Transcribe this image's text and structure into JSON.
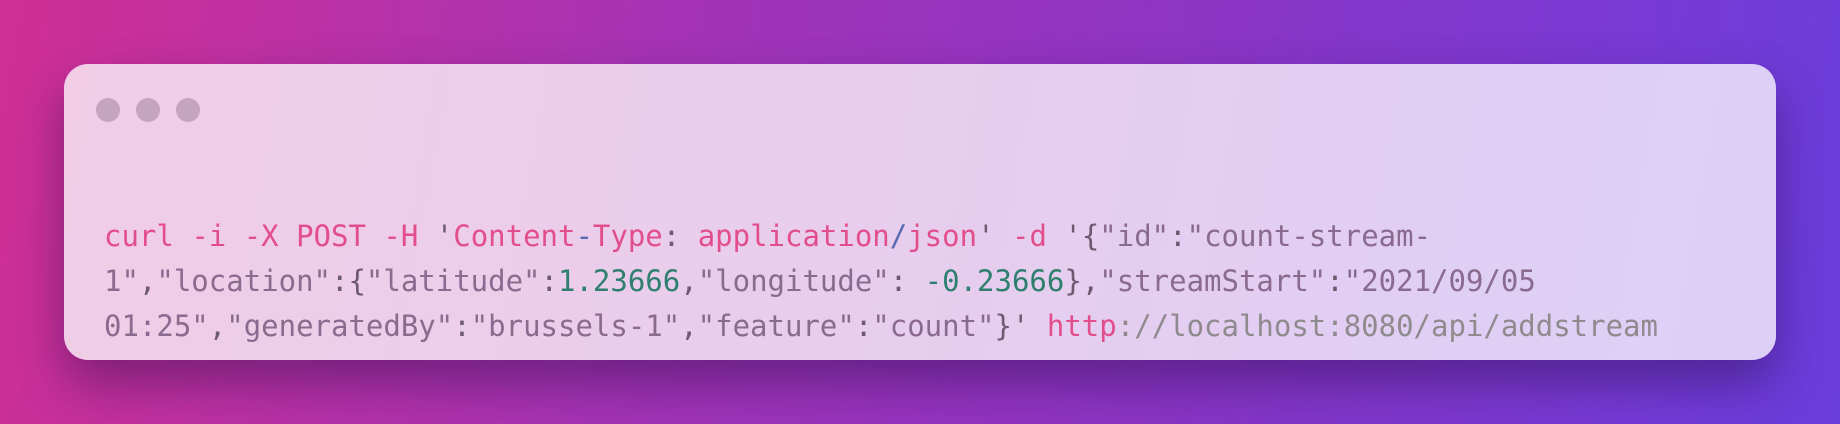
{
  "window": {
    "traffic_lights": [
      "dot",
      "dot",
      "dot"
    ],
    "colors": {
      "background_start": "#d02f95",
      "background_end": "#6b3ddd",
      "card": "#ead0ef",
      "dot": "#c5a4bf",
      "keyword": "#e24e8c",
      "string": "#8a6a8e",
      "number": "#2f7f6e",
      "slash": "#5a6ab0",
      "url": "#8f8a8d"
    }
  },
  "code": {
    "line1": {
      "t1": "curl",
      "t2": " ",
      "t3": "-i",
      "t4": " ",
      "t5": "-X POST",
      "t6": " ",
      "t7": "-H",
      "t8": " '",
      "t9": "Content",
      "t10": "-",
      "t11": "Type",
      "t12": ": ",
      "t13": "application",
      "t14": "/",
      "t15": "json",
      "t16": "' ",
      "t17": "-d",
      "t18": " '{",
      "t19": "\"id\"",
      "t20": ":",
      "t21": "\"count-stream-"
    },
    "line2": {
      "t1": "1\"",
      "t2": ",",
      "t3": "\"location\"",
      "t4": ":{",
      "t5": "\"latitude\"",
      "t6": ":",
      "t7": "1.23666",
      "t8": ",",
      "t9": "\"longitude\"",
      "t10": ": ",
      "t11": "-0.23666",
      "t12": "},",
      "t13": "\"streamStart\"",
      "t14": ":",
      "t15": "\"2021/09/05"
    },
    "line3": {
      "t1": "01:25\"",
      "t2": ",",
      "t3": "\"generatedBy\"",
      "t4": ":",
      "t5": "\"brussels-1\"",
      "t6": ",",
      "t7": "\"feature\"",
      "t8": ":",
      "t9": "\"count\"",
      "t10": "}' ",
      "t11": "http",
      "t12": "://localhost:8080/api/addstream"
    }
  }
}
